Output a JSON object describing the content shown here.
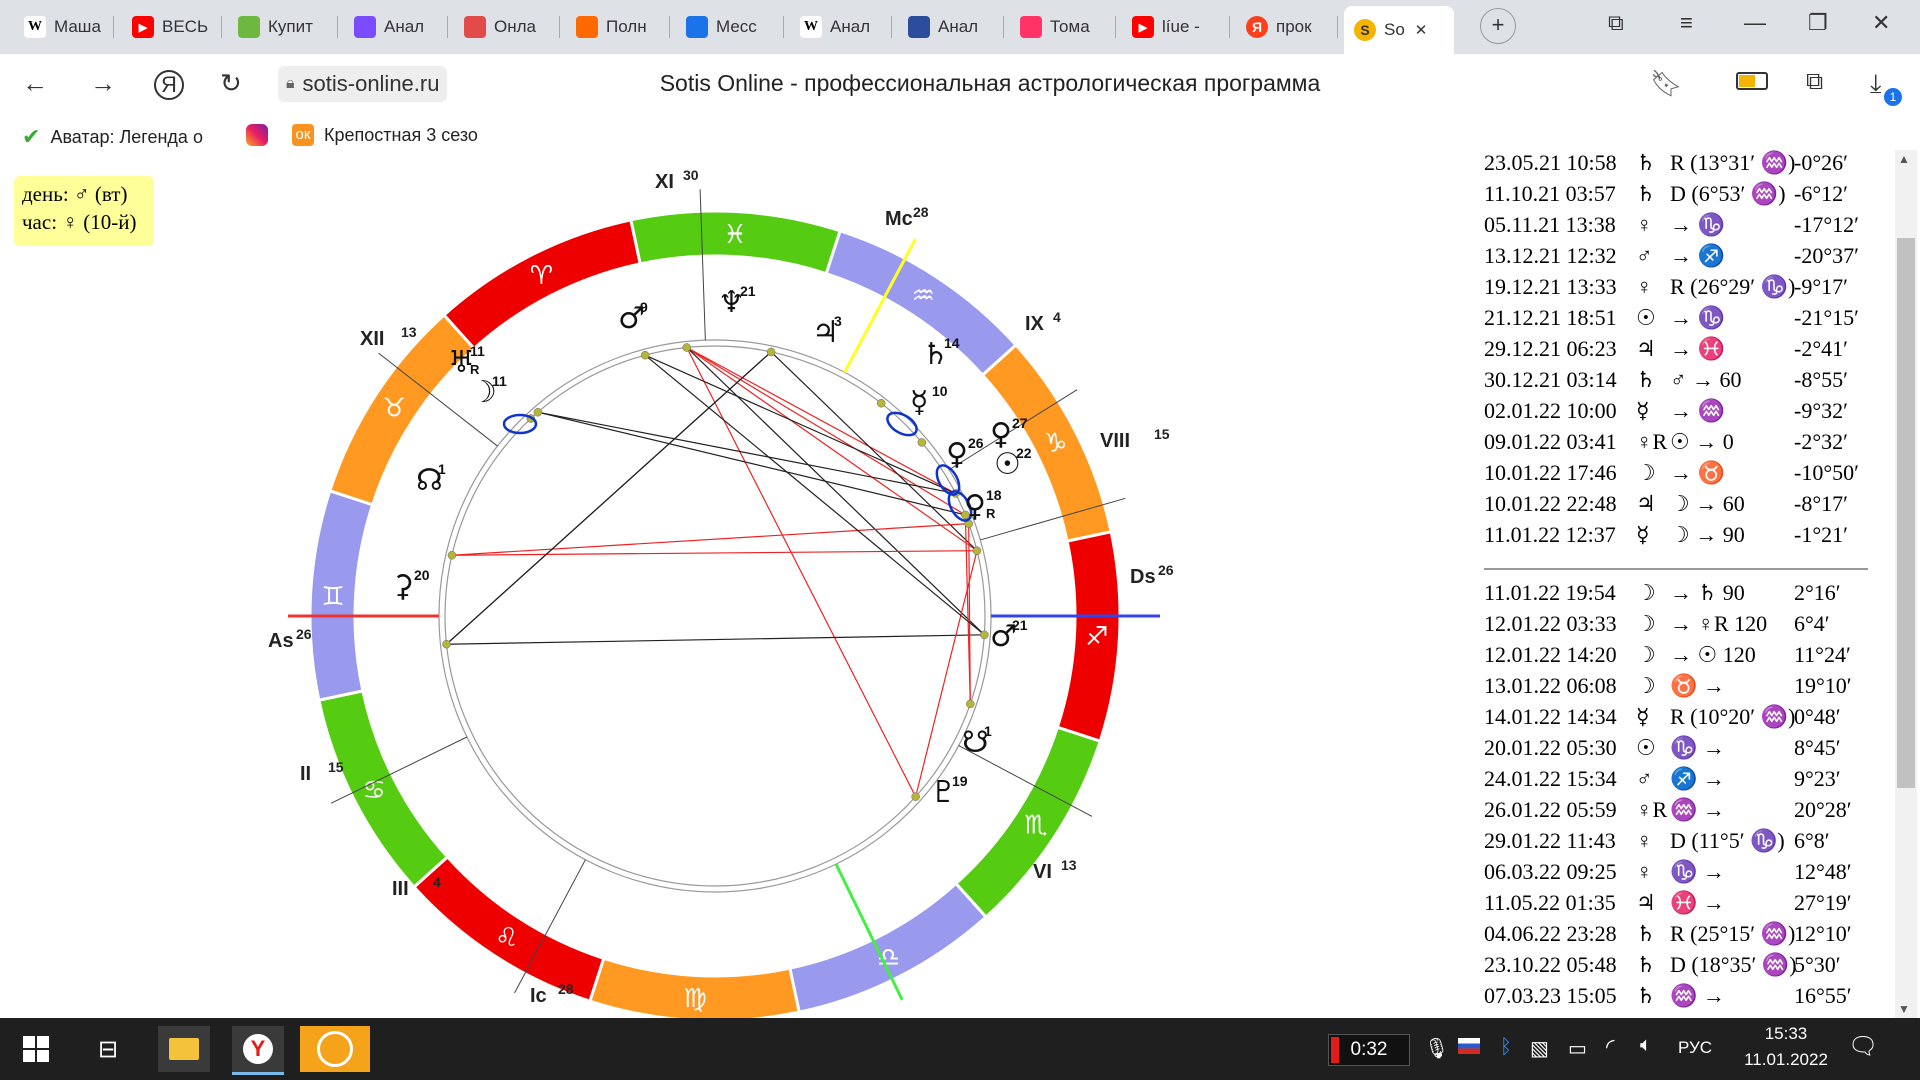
{
  "browser": {
    "tabs": [
      {
        "label": "Маша",
        "icon": "wikipedia-icon",
        "color": "#ffffff"
      },
      {
        "label": "ВЕСЬ",
        "icon": "youtube-icon",
        "color": "#ff0000"
      },
      {
        "label": "Купит",
        "icon": "avito-icon",
        "color": "#6fb83f"
      },
      {
        "label": "Анал",
        "icon": "search-q-icon",
        "color": "#7b4cff"
      },
      {
        "label": "Онла",
        "icon": "online-icon",
        "color": "#e34b4b"
      },
      {
        "label": "Полн",
        "icon": "flame-icon",
        "color": "#ff6a00"
      },
      {
        "label": "Месс",
        "icon": "messenger-icon",
        "color": "#1a73e8"
      },
      {
        "label": "Анал",
        "icon": "wikipedia-icon",
        "color": "#ffffff"
      },
      {
        "label": "Анал",
        "icon": "shield-icon",
        "color": "#2c4c9c"
      },
      {
        "label": "Тома",
        "icon": "flame-icon",
        "color": "#ff3366"
      },
      {
        "label": "líue -",
        "icon": "youtube-icon",
        "color": "#ff0000"
      },
      {
        "label": "прок",
        "icon": "yandex-icon",
        "color": "#fc3f1d"
      },
      {
        "label": "So",
        "icon": "sotis-icon",
        "color": "#f4b400"
      }
    ],
    "url": "sotis-online.ru",
    "page_title": "Sotis Online - профессиональная астрологическая программа",
    "bookmarks": [
      "Аватар: Легенда о",
      "Крепостная 3 сезо"
    ],
    "download_badge": "1"
  },
  "info": {
    "day_line": "день: ♂ (вт)",
    "hour_line": "час: ♀ (10-й)"
  },
  "chart": {
    "houses": [
      {
        "label": "XI",
        "deg": "30"
      },
      {
        "label": "Mc",
        "deg": "28"
      },
      {
        "label": "IX",
        "deg": "4"
      },
      {
        "label": "VIII",
        "deg": "15"
      },
      {
        "label": "Ds",
        "deg": "26"
      },
      {
        "label": "VI",
        "deg": "13"
      },
      {
        "label": "Ic",
        "deg": "28"
      },
      {
        "label": "III",
        "deg": "4"
      },
      {
        "label": "II",
        "deg": "15"
      },
      {
        "label": "As",
        "deg": "26"
      },
      {
        "label": "XII",
        "deg": "13"
      }
    ],
    "signs": [
      {
        "glyph": "♓",
        "color": "#55cc11"
      },
      {
        "glyph": "♒",
        "color": "#9999ee"
      },
      {
        "glyph": "♑",
        "color": "#ff9922"
      },
      {
        "glyph": "♐",
        "color": "#ee0000"
      },
      {
        "glyph": "♏",
        "color": "#55cc11"
      },
      {
        "glyph": "♎",
        "color": "#9999ee"
      },
      {
        "glyph": "♍",
        "color": "#ff9922"
      },
      {
        "glyph": "♌",
        "color": "#ee0000"
      },
      {
        "glyph": "♋",
        "color": "#55cc11"
      },
      {
        "glyph": "♊",
        "color": "#9999ee"
      },
      {
        "glyph": "♉",
        "color": "#ff9922"
      },
      {
        "glyph": "♈",
        "color": "#ee0000"
      }
    ],
    "planets": [
      {
        "glyph": "♆",
        "deg": "21",
        "sub": ""
      },
      {
        "glyph": "♂",
        "deg": "9",
        "sub": ""
      },
      {
        "glyph": "♃",
        "deg": "3",
        "sub": ""
      },
      {
        "glyph": "♄",
        "deg": "14",
        "sub": ""
      },
      {
        "glyph": "♅",
        "deg": "11",
        "sub": "R"
      },
      {
        "glyph": "☽",
        "deg": "11",
        "sub": ""
      },
      {
        "glyph": "☿",
        "deg": "10",
        "sub": ""
      },
      {
        "glyph": "♀",
        "deg": "27",
        "sub": ""
      },
      {
        "glyph": "♀",
        "deg": "26",
        "sub": ""
      },
      {
        "glyph": "☉",
        "deg": "22",
        "sub": ""
      },
      {
        "glyph": "♀",
        "deg": "18",
        "sub": "R"
      },
      {
        "glyph": "☊",
        "deg": "1",
        "sub": ""
      },
      {
        "glyph": "⚳",
        "deg": "20",
        "sub": ""
      },
      {
        "glyph": "♂",
        "deg": "21",
        "sub": ""
      },
      {
        "glyph": "☋",
        "deg": "1",
        "sub": ""
      },
      {
        "glyph": "♇",
        "deg": "19",
        "sub": ""
      }
    ]
  },
  "events_top": [
    {
      "date": "23.05.21 10:58",
      "p": "♄",
      "act": "R (13°31′ ♒)",
      "val": "-0°26′"
    },
    {
      "date": "11.10.21 03:57",
      "p": "♄",
      "act": "D (6°53′ ♒)",
      "val": "-6°12′"
    },
    {
      "date": "05.11.21 13:38",
      "p": "♀",
      "act": "→ ♑",
      "val": "-17°12′"
    },
    {
      "date": "13.12.21 12:32",
      "p": "♂",
      "act": "→ ♐",
      "val": "-20°37′"
    },
    {
      "date": "19.12.21 13:33",
      "p": "♀",
      "act": "R (26°29′ ♑)",
      "val": "-9°17′"
    },
    {
      "date": "21.12.21 18:51",
      "p": "☉",
      "act": "→ ♑",
      "val": "-21°15′"
    },
    {
      "date": "29.12.21 06:23",
      "p": "♃",
      "act": "→ ♓",
      "val": "-2°41′"
    },
    {
      "date": "30.12.21 03:14",
      "p": "♄",
      "act": "♂ → 60",
      "val": "-8°55′"
    },
    {
      "date": "02.01.22 10:00",
      "p": "☿",
      "act": "→ ♒",
      "val": "-9°32′"
    },
    {
      "date": "09.01.22 03:41",
      "p": "♀R",
      "act": "☉ → 0",
      "val": "-2°32′"
    },
    {
      "date": "10.01.22 17:46",
      "p": "☽",
      "act": "→ ♉",
      "val": "-10°50′"
    },
    {
      "date": "10.01.22 22:48",
      "p": "♃",
      "act": "☽ → 60",
      "val": "-8°17′"
    },
    {
      "date": "11.01.22 12:37",
      "p": "☿",
      "act": "☽ → 90",
      "val": "-1°21′"
    }
  ],
  "events_bottom": [
    {
      "date": "11.01.22 19:54",
      "p": "☽",
      "act": "→ ♄ 90",
      "val": "2°16′"
    },
    {
      "date": "12.01.22 03:33",
      "p": "☽",
      "act": "→ ♀R 120",
      "val": "6°4′"
    },
    {
      "date": "12.01.22 14:20",
      "p": "☽",
      "act": "→ ☉ 120",
      "val": "11°24′"
    },
    {
      "date": "13.01.22 06:08",
      "p": "☽",
      "act": "♉ →",
      "val": "19°10′"
    },
    {
      "date": "14.01.22 14:34",
      "p": "☿",
      "act": "R (10°20′ ♒)",
      "val": "0°48′"
    },
    {
      "date": "20.01.22 05:30",
      "p": "☉",
      "act": "♑ →",
      "val": "8°45′"
    },
    {
      "date": "24.01.22 15:34",
      "p": "♂",
      "act": "♐ →",
      "val": "9°23′"
    },
    {
      "date": "26.01.22 05:59",
      "p": "♀R",
      "act": "♒ →",
      "val": "20°28′"
    },
    {
      "date": "29.01.22 11:43",
      "p": "♀",
      "act": "D (11°5′ ♑)",
      "val": "6°8′"
    },
    {
      "date": "06.03.22 09:25",
      "p": "♀",
      "act": "♑ →",
      "val": "12°48′"
    },
    {
      "date": "11.05.22 01:35",
      "p": "♃",
      "act": "♓ →",
      "val": "27°19′"
    },
    {
      "date": "04.06.22 23:28",
      "p": "♄",
      "act": "R (25°15′ ♒)",
      "val": "12°10′"
    },
    {
      "date": "23.10.22 05:48",
      "p": "♄",
      "act": "D (18°35′ ♒)",
      "val": "5°30′"
    },
    {
      "date": "07.03.23 15:05",
      "p": "♄",
      "act": "♒ →",
      "val": "16°55′"
    }
  ],
  "taskbar": {
    "recording_time": "0:32",
    "language": "РУС",
    "time": "15:33",
    "date": "11.01.2022"
  }
}
